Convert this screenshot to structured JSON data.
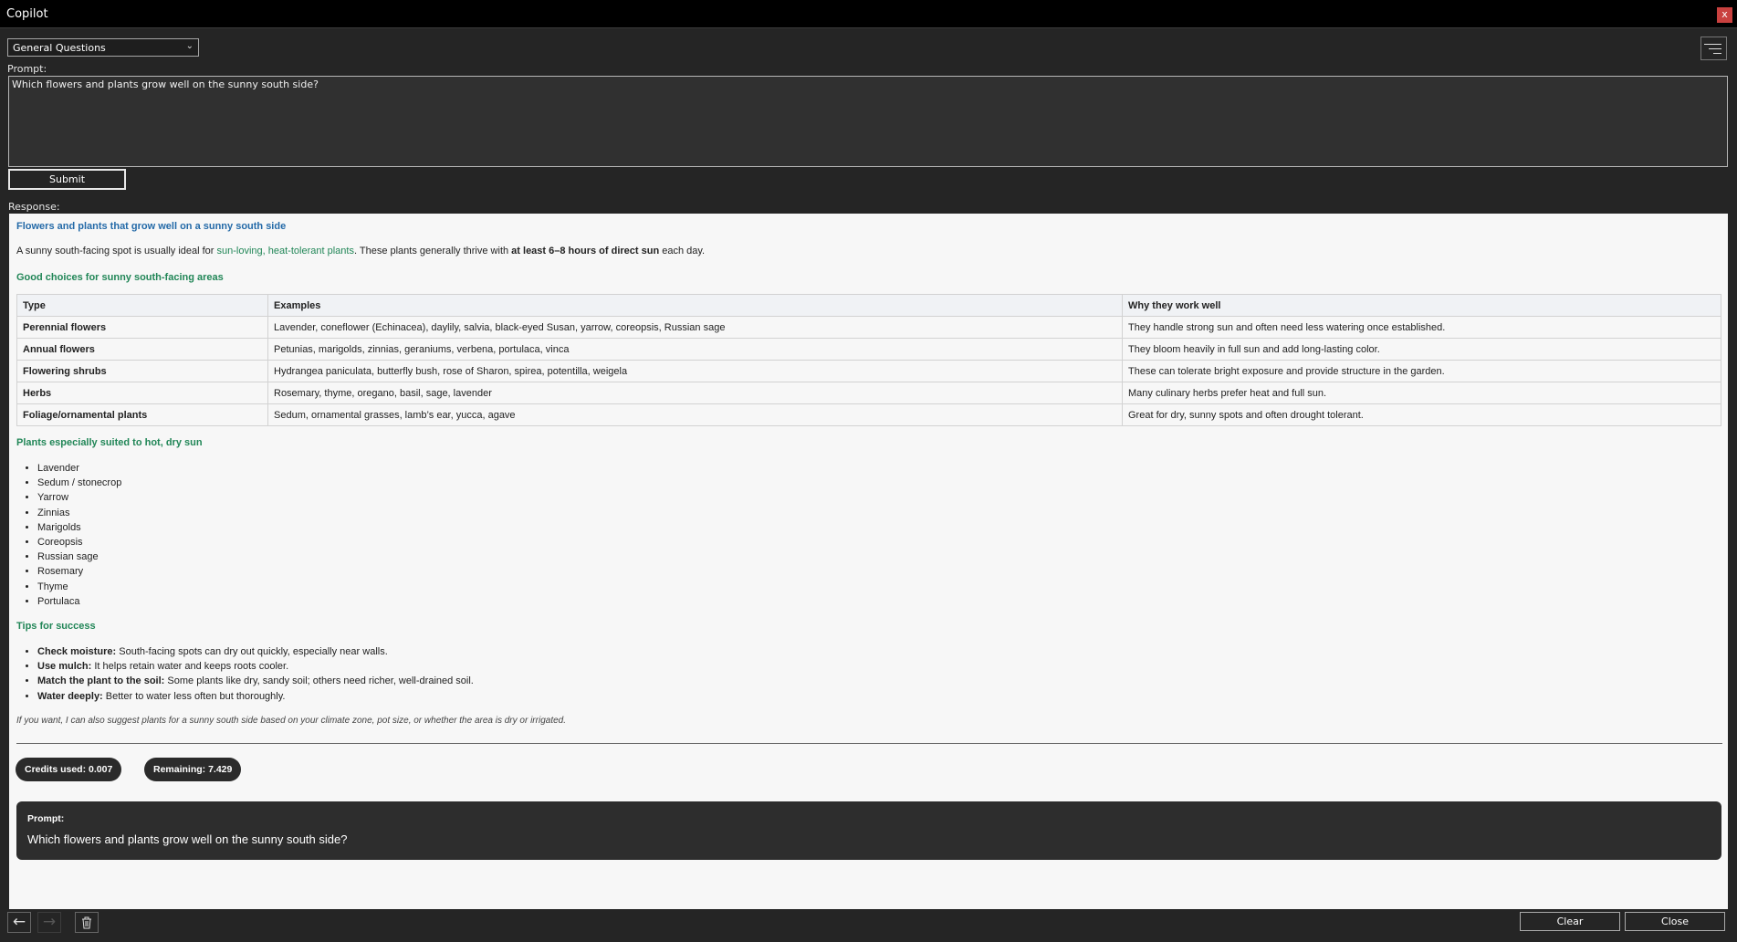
{
  "window": {
    "title": "Copilot",
    "close_glyph": "x"
  },
  "category_select": {
    "value": "General Questions"
  },
  "prompt": {
    "label": "Prompt:",
    "value": "Which flowers and plants grow well on the sunny south side?"
  },
  "submit_label": "Submit",
  "response_label": "Response:",
  "response": {
    "heading": "Flowers and plants that grow well on a sunny south side",
    "intro": {
      "before": "A sunny south-facing spot is usually ideal for ",
      "highlight": "sun-loving, heat-tolerant plants",
      "middle": ". These plants generally thrive with ",
      "bold": "at least 6–8 hours of direct sun",
      "after": " each day."
    },
    "good_choices_heading": "Good choices for sunny south-facing areas",
    "table": {
      "headers": [
        "Type",
        "Examples",
        "Why they work well"
      ],
      "rows": [
        [
          "Perennial flowers",
          "Lavender, coneflower (Echinacea), daylily, salvia, black-eyed Susan, yarrow, coreopsis, Russian sage",
          "They handle strong sun and often need less watering once established."
        ],
        [
          "Annual flowers",
          "Petunias, marigolds, zinnias, geraniums, verbena, portulaca, vinca",
          "They bloom heavily in full sun and add long-lasting color."
        ],
        [
          "Flowering shrubs",
          "Hydrangea paniculata, butterfly bush, rose of Sharon, spirea, potentilla, weigela",
          "These can tolerate bright exposure and provide structure in the garden."
        ],
        [
          "Herbs",
          "Rosemary, thyme, oregano, basil, sage, lavender",
          "Many culinary herbs prefer heat and full sun."
        ],
        [
          "Foliage/ornamental plants",
          "Sedum, ornamental grasses, lamb’s ear, yucca, agave",
          "Great for dry, sunny spots and often drought tolerant."
        ]
      ]
    },
    "hot_dry_heading": "Plants especially suited to hot, dry sun",
    "hot_dry_list": [
      "Lavender",
      "Sedum / stonecrop",
      "Yarrow",
      "Zinnias",
      "Marigolds",
      "Coreopsis",
      "Russian sage",
      "Rosemary",
      "Thyme",
      "Portulaca"
    ],
    "tips_heading": "Tips for success",
    "tips": [
      {
        "title": "Check moisture:",
        "text": " South-facing spots can dry out quickly, especially near walls."
      },
      {
        "title": "Use mulch:",
        "text": " It helps retain water and keeps roots cooler."
      },
      {
        "title": "Match the plant to the soil:",
        "text": " Some plants like dry, sandy soil; others need richer, well-drained soil."
      },
      {
        "title": "Water deeply:",
        "text": " Better to water less often but thoroughly."
      }
    ],
    "footnote": "If you want, I can also suggest plants for a sunny south side based on your climate zone, pot size, or whether the area is dry or irrigated.",
    "credits_used": "Credits used: 0.007",
    "remaining": "Remaining: 7.429",
    "prompt_card": {
      "label": "Prompt:",
      "text": "Which flowers and plants grow well on the sunny south side?"
    }
  },
  "bottom": {
    "clear_label": "Clear",
    "close_label": "Close"
  }
}
